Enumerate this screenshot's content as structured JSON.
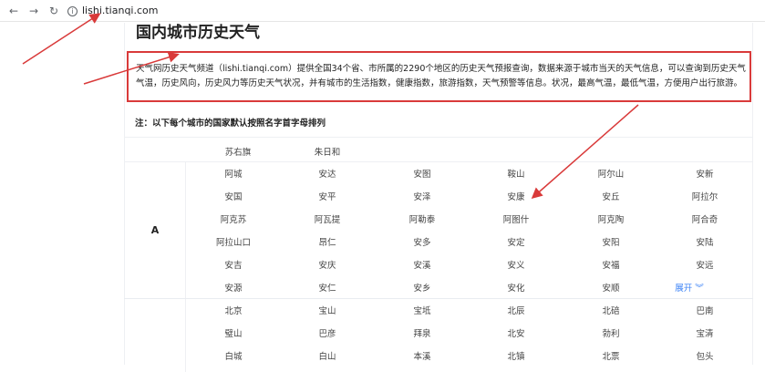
{
  "browser": {
    "url": "lishi.tianqi.com",
    "back_icon": "←",
    "forward_icon": "→",
    "reload_icon": "↻",
    "info_icon": "i"
  },
  "page": {
    "title": "国内城市历史天气",
    "description": "天气网历史天气频道（lishi.tianqi.com）提供全国34个省、市所属的2290个地区的历史天气预报查询，数据来源于城市当天的天气信息，可以查询到历史天气气温，历史风向，历史风力等历史天气状况，并有城市的生活指数，健康指数，旅游指数，天气预警等信息。状况，最高气温，最低气温，方便用户出行旅游。",
    "note": "注：以下每个城市的国家默认按照名字首字母排列",
    "top_row": [
      "苏右旗",
      "朱日和"
    ],
    "groups": [
      {
        "letter": "A",
        "cities": [
          [
            "阿城",
            "安达",
            "安图",
            "鞍山",
            "阿尔山",
            "安新"
          ],
          [
            "安国",
            "安平",
            "安泽",
            "安康",
            "安丘",
            "阿拉尔"
          ],
          [
            "阿克苏",
            "阿瓦提",
            "阿勒泰",
            "阿图什",
            "阿克陶",
            "阿合奇"
          ],
          [
            "阿拉山口",
            "昂仁",
            "安多",
            "安定",
            "安阳",
            "安陆"
          ],
          [
            "安吉",
            "安庆",
            "安溪",
            "安义",
            "安福",
            "安远"
          ],
          [
            "安源",
            "安仁",
            "安乡",
            "安化",
            "安顺",
            ""
          ]
        ],
        "more_label": "展开"
      },
      {
        "letter": "B",
        "cities": [
          [
            "北京",
            "宝山",
            "宝坻",
            "北辰",
            "北碚",
            "巴南"
          ],
          [
            "璧山",
            "巴彦",
            "拜泉",
            "北安",
            "勃利",
            "宝清"
          ],
          [
            "白城",
            "白山",
            "本溪",
            "北镇",
            "北票",
            "包头"
          ]
        ]
      }
    ]
  },
  "colors": {
    "annotation_red": "#d93a3a",
    "link_blue": "#3b82f6"
  }
}
